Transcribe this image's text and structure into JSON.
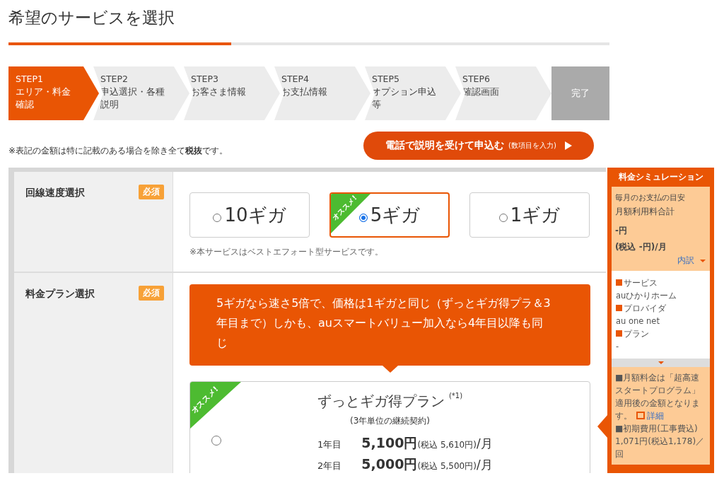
{
  "page_title": "希望のサービスを選択",
  "progress": {
    "level": 0.37
  },
  "steps": [
    {
      "kind": "step",
      "label": "STEP1",
      "text": "エリア・料金確認",
      "selected": true
    },
    {
      "kind": "step",
      "label": "STEP2",
      "text": "申込選択・各種説明",
      "selected": false
    },
    {
      "kind": "step",
      "label": "STEP3",
      "text": "お客さま情報",
      "selected": false
    },
    {
      "kind": "step",
      "label": "STEP4",
      "text": "お支払情報",
      "selected": false
    },
    {
      "kind": "step",
      "label": "STEP5",
      "text": "オプション申込等",
      "selected": false
    },
    {
      "kind": "step",
      "label": "STEP6",
      "text": "確認画面",
      "selected": false
    },
    {
      "kind": "done",
      "text": "完了",
      "selected": false
    }
  ],
  "tax_note": "※表記の金額は特に記載のある場合を除き全て**税抜**です。",
  "call_button": {
    "label": "電話で説明を受けて申込む",
    "sub": "(数項目を入力)"
  },
  "speed_section": {
    "label": "回線速度選択",
    "badge": "必須",
    "options": [
      {
        "label": "10ギガ",
        "selected": false
      },
      {
        "label": "5ギガ",
        "selected": true,
        "ribbon": "オススメ!"
      },
      {
        "label": "1ギガ",
        "selected": false
      }
    ],
    "note": "※本サービスはベストエフォート型サービスです。"
  },
  "plan_section": {
    "label": "料金プラン選択",
    "badge": "必須",
    "banner": "5ギガなら速さ5倍で、価格は1ギガと同じ（ずっとギガ得プラ＆3年目まで）しかも、auスマートバリュー加入なら4年目以降も同じ",
    "plans": [
      {
        "name": "ずっとギガ得プラン",
        "footnote": "(*1)",
        "term": "(3年単位の継続契約)",
        "ribbon": "オススメ!",
        "selected": false,
        "prices": [
          {
            "year": "1年目",
            "price": "5,100円",
            "tax": "(税込 5,610円)",
            "unit": "/月"
          },
          {
            "year": "2年目",
            "price": "5,000円",
            "tax": "(税込 5,500円)",
            "unit": "/月"
          }
        ]
      }
    ]
  },
  "simulation": {
    "title": "料金シミュレーション",
    "caption": "毎月のお支払の目安",
    "total_label": "月額利用料合計",
    "amount": "-円",
    "amount_tax": "(税込 -円)/月",
    "breakdown_link": "内訳",
    "items": [
      {
        "heading": "サービス",
        "value": "auひかりホーム"
      },
      {
        "heading": "プロバイダ",
        "value": "au one net"
      },
      {
        "heading": "プラン",
        "value": "-"
      }
    ],
    "note": "■月額料金は「超高速スタートプログラム」適用後の金額となります。",
    "detail_link": "詳細",
    "initial_label": "■初期費用(工事費込)",
    "initial_value": "1,071円(税込1,178)／回"
  }
}
